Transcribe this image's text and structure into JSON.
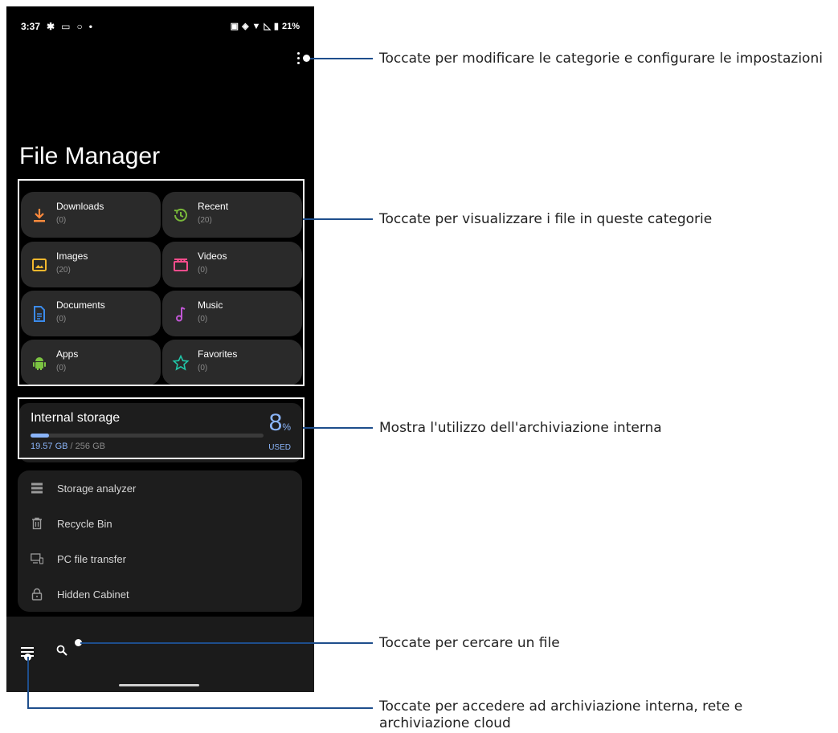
{
  "status_bar": {
    "time": "3:37",
    "battery": "21%"
  },
  "app": {
    "title": "File Manager"
  },
  "categories": [
    {
      "label": "Downloads",
      "count": "(0)",
      "icon": "download-icon",
      "color": "#ff8a3d"
    },
    {
      "label": "Recent",
      "count": "(20)",
      "icon": "history-icon",
      "color": "#79b83a"
    },
    {
      "label": "Images",
      "count": "(20)",
      "icon": "image-icon",
      "color": "#f5b82e"
    },
    {
      "label": "Videos",
      "count": "(0)",
      "icon": "clapperboard-icon",
      "color": "#ff4d8d"
    },
    {
      "label": "Documents",
      "count": "(0)",
      "icon": "document-icon",
      "color": "#3b8beb"
    },
    {
      "label": "Music",
      "count": "(0)",
      "icon": "music-note-icon",
      "color": "#c257d6"
    },
    {
      "label": "Apps",
      "count": "(0)",
      "icon": "android-icon",
      "color": "#7cc442"
    },
    {
      "label": "Favorites",
      "count": "(0)",
      "icon": "star-icon",
      "color": "#20c6a8"
    }
  ],
  "storage": {
    "title": "Internal storage",
    "used": "19.57 GB",
    "total": "/ 256 GB",
    "percent": "8",
    "percent_sign": "%",
    "used_label": "USED",
    "fraction": 0.08
  },
  "tools": [
    {
      "label": "Storage analyzer",
      "icon": "storage-analyzer-icon"
    },
    {
      "label": "Recycle Bin",
      "icon": "trash-icon"
    },
    {
      "label": "PC file transfer",
      "icon": "pc-transfer-icon"
    },
    {
      "label": "Hidden Cabinet",
      "icon": "lock-icon"
    }
  ],
  "callouts": {
    "menu": "Toccate per modificare le categorie e configurare le impostazioni",
    "categories": "Toccate per visualizzare i file in queste categorie",
    "storage": "Mostra l'utilizzo dell'archiviazione interna",
    "search": "Toccate per cercare un file",
    "nav_line1": "Toccate per accedere ad archiviazione interna, rete e",
    "nav_line2": "archiviazione cloud"
  },
  "colors": {
    "accent": "#8ab4f8",
    "callout_line": "#1e4e8c"
  }
}
